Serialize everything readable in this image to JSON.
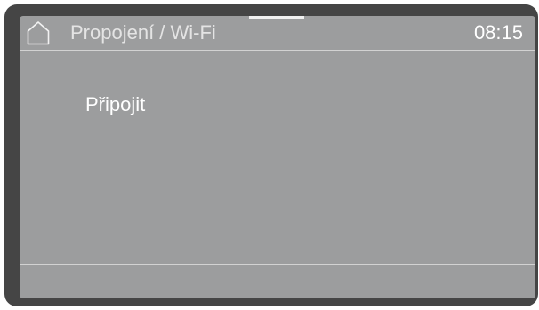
{
  "header": {
    "home_icon": "home-icon",
    "title": "Propojení / Wi-Fi",
    "time": "08:15"
  },
  "menu": {
    "items": [
      {
        "label": "Připojit"
      }
    ]
  },
  "colors": {
    "bezel": "#454545",
    "screen_background": "#9c9d9e",
    "divider": "#d2d2d2",
    "text": "#ffffff"
  }
}
